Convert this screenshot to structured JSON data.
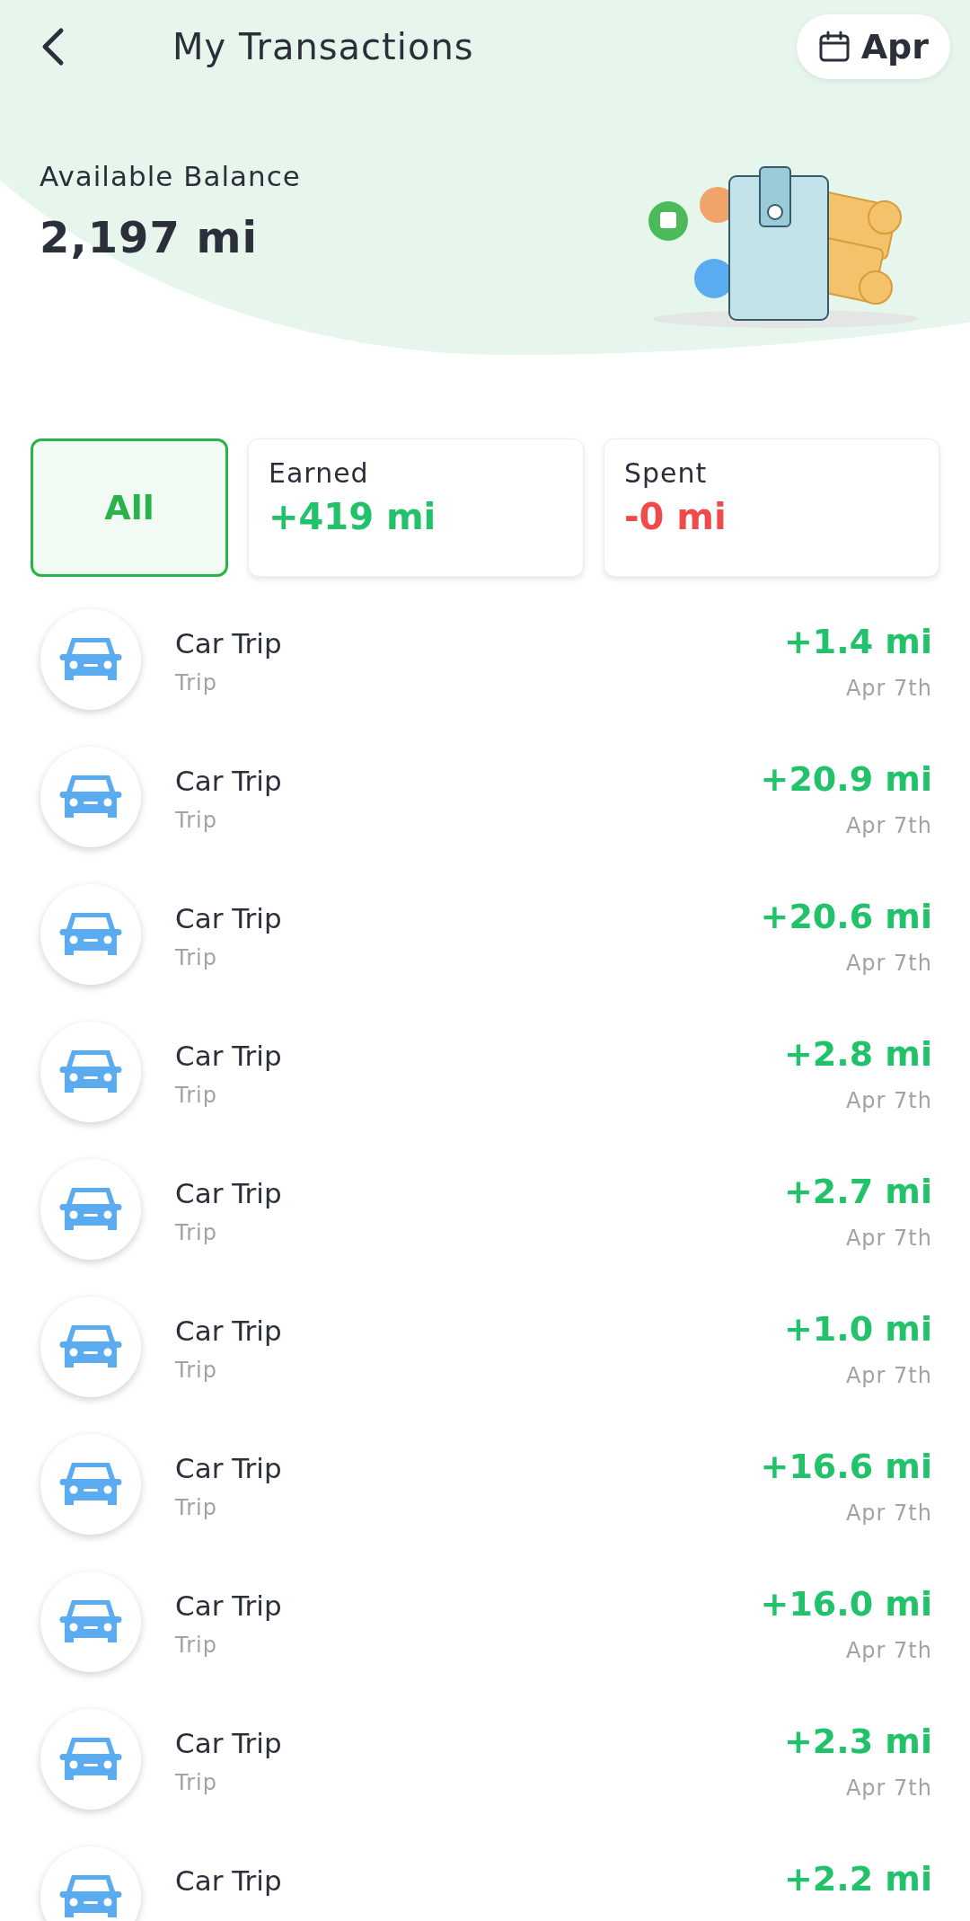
{
  "header": {
    "title": "My Transactions",
    "month_button": "Apr"
  },
  "balance": {
    "label": "Available Balance",
    "value": "2,197 mi"
  },
  "filters": [
    {
      "kind": "all",
      "label": "All",
      "selected": true
    },
    {
      "kind": "earned",
      "label": "Earned",
      "amount": "+419 mi",
      "selected": false
    },
    {
      "kind": "spent",
      "label": "Spent",
      "amount": "-0 mi",
      "selected": false
    }
  ],
  "transactions": [
    {
      "title": "Car Trip",
      "subtitle": "Trip",
      "amount": "+1.4 mi",
      "date": "Apr 7th"
    },
    {
      "title": "Car Trip",
      "subtitle": "Trip",
      "amount": "+20.9 mi",
      "date": "Apr 7th"
    },
    {
      "title": "Car Trip",
      "subtitle": "Trip",
      "amount": "+20.6 mi",
      "date": "Apr 7th"
    },
    {
      "title": "Car Trip",
      "subtitle": "Trip",
      "amount": "+2.8 mi",
      "date": "Apr 7th"
    },
    {
      "title": "Car Trip",
      "subtitle": "Trip",
      "amount": "+2.7 mi",
      "date": "Apr 7th"
    },
    {
      "title": "Car Trip",
      "subtitle": "Trip",
      "amount": "+1.0 mi",
      "date": "Apr 7th"
    },
    {
      "title": "Car Trip",
      "subtitle": "Trip",
      "amount": "+16.6 mi",
      "date": "Apr 7th"
    },
    {
      "title": "Car Trip",
      "subtitle": "Trip",
      "amount": "+16.0 mi",
      "date": "Apr 7th"
    },
    {
      "title": "Car Trip",
      "subtitle": "Trip",
      "amount": "+2.3 mi",
      "date": "Apr 7th"
    },
    {
      "title": "Car Trip",
      "amount": "+2.2 mi"
    }
  ]
}
